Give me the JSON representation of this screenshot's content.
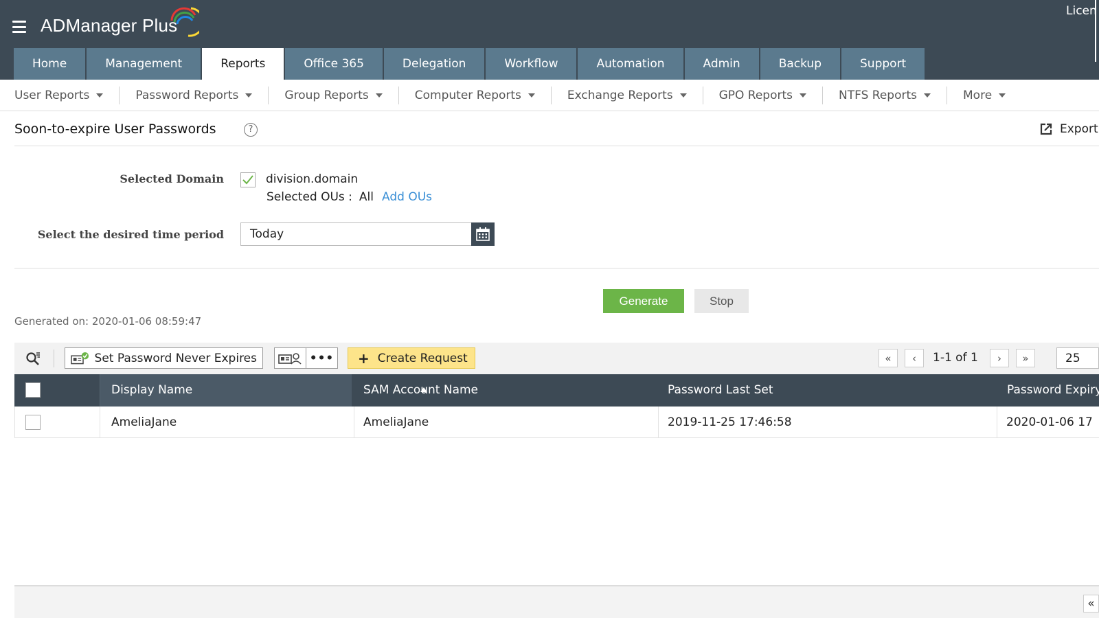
{
  "app": {
    "title": "ADManager Plus",
    "license_text": "Licen"
  },
  "tabs": [
    {
      "label": "Home"
    },
    {
      "label": "Management"
    },
    {
      "label": "Reports",
      "active": true
    },
    {
      "label": "Office 365"
    },
    {
      "label": "Delegation"
    },
    {
      "label": "Workflow"
    },
    {
      "label": "Automation"
    },
    {
      "label": "Admin"
    },
    {
      "label": "Backup"
    },
    {
      "label": "Support"
    }
  ],
  "subnav": [
    {
      "label": "User Reports"
    },
    {
      "label": "Password Reports"
    },
    {
      "label": "Group Reports"
    },
    {
      "label": "Computer Reports"
    },
    {
      "label": "Exchange Reports"
    },
    {
      "label": "GPO Reports"
    },
    {
      "label": "NTFS Reports"
    },
    {
      "label": "More"
    }
  ],
  "report": {
    "title": "Soon-to-expire User Passwords",
    "help_symbol": "?",
    "export_label": "Export"
  },
  "form": {
    "domain_label": "Selected Domain",
    "domain_value": "division.domain",
    "domain_checked": true,
    "ou_label": "Selected OUs :",
    "ou_value": "All",
    "add_ous_label": "Add OUs",
    "time_label": "Select the desired time period",
    "time_value": "Today"
  },
  "actions": {
    "generate_label": "Generate",
    "stop_label": "Stop"
  },
  "generated_on": "Generated on: 2020-01-06 08:59:47",
  "toolbar": {
    "set_never_expires_label": "Set Password Never Expires",
    "more_symbol": "•••",
    "create_request_label": "Create Request",
    "pagination_text": "1-1 of 1",
    "page_size": "25"
  },
  "table": {
    "columns": [
      "Display Name",
      "SAM Account Name",
      "Password Last Set",
      "Password Expiry"
    ],
    "sorted_column": "Display Name",
    "rows": [
      {
        "display_name": "AmeliaJane",
        "sam_account_name": "AmeliaJane",
        "password_last_set": "2019-11-25 17:46:58",
        "password_expiry": "2020-01-06 17"
      }
    ]
  },
  "footer": {
    "collapse_symbol": "«"
  },
  "colors": {
    "header_bg": "#3d4a55",
    "tab_bg": "#5b7a8e",
    "generate_green": "#6cb548",
    "create_request_yellow": "#fde48a",
    "link_blue": "#3a8fd6"
  }
}
